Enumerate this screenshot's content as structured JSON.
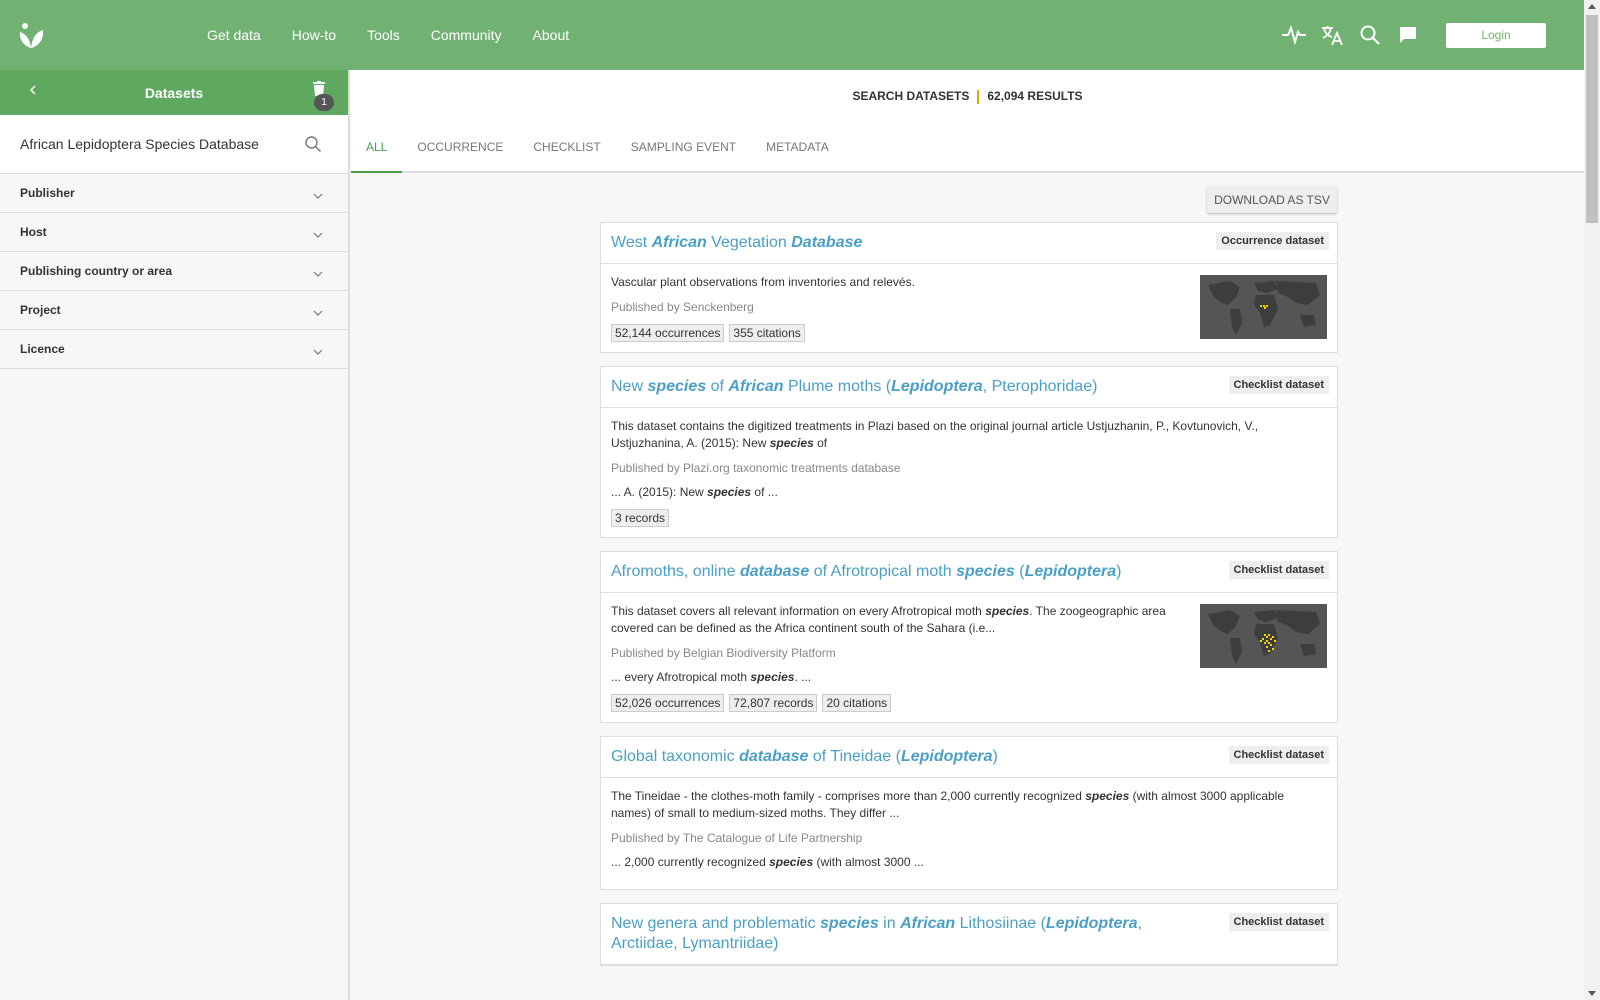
{
  "nav": {
    "items": [
      "Get data",
      "How-to",
      "Tools",
      "Community",
      "About"
    ],
    "login_label": "Login"
  },
  "sidebar": {
    "title": "Datasets",
    "badge_count": "1",
    "search_value": "African Lepidoptera Species Database",
    "filters": [
      "Publisher",
      "Host",
      "Publishing country or area",
      "Project",
      "Licence"
    ]
  },
  "results": {
    "label": "SEARCH DATASETS",
    "count": "62,094 RESULTS"
  },
  "tabs": [
    "ALL",
    "OCCURRENCE",
    "CHECKLIST",
    "SAMPLING EVENT",
    "METADATA"
  ],
  "download_label": "DOWNLOAD AS TSV",
  "datasets": [
    {
      "title_parts": [
        [
          "West ",
          false
        ],
        [
          "African",
          true
        ],
        [
          " Vegetation ",
          false
        ],
        [
          "Database",
          true
        ]
      ],
      "type": "Occurrence dataset",
      "description_parts": [
        [
          "Vascular plant observations from inventories and relevés.",
          false
        ]
      ],
      "published": "Published by Senckenberg",
      "snippet_parts": [],
      "tags": [
        "52,144 occurrences",
        "355 citations"
      ],
      "has_map": true
    },
    {
      "title_parts": [
        [
          "New ",
          false
        ],
        [
          "species",
          true
        ],
        [
          " of ",
          false
        ],
        [
          "African",
          true
        ],
        [
          " Plume moths (",
          false
        ],
        [
          "Lepidoptera",
          true
        ],
        [
          ", Pterophoridae)",
          false
        ]
      ],
      "type": "Checklist dataset",
      "description_parts": [
        [
          "This dataset contains the digitized treatments in Plazi based on the original journal article Ustjuzhanin, P., Kovtunovich, V., Ustjuzhanina, A. (2015): New ",
          false
        ],
        [
          "species",
          true
        ],
        [
          " of",
          false
        ]
      ],
      "published": "Published by Plazi.org taxonomic treatments database",
      "snippet_parts": [
        [
          "... A. (2015): New ",
          false
        ],
        [
          "species",
          true
        ],
        [
          " of ...",
          false
        ]
      ],
      "tags": [
        "3 records"
      ],
      "has_map": false
    },
    {
      "title_parts": [
        [
          "Afromoths, online ",
          false
        ],
        [
          "database",
          true
        ],
        [
          " of Afrotropical moth ",
          false
        ],
        [
          "species",
          true
        ],
        [
          " (",
          false
        ],
        [
          "Lepidoptera",
          true
        ],
        [
          ")",
          false
        ]
      ],
      "type": "Checklist dataset",
      "description_parts": [
        [
          "This dataset covers all relevant information on every Afrotropical moth ",
          false
        ],
        [
          "species",
          true
        ],
        [
          ". The zoogeographic area covered can be defined as the Africa continent south of the Sahara (i.e...",
          false
        ]
      ],
      "published": "Published by Belgian Biodiversity Platform",
      "snippet_parts": [
        [
          "... every Afrotropical moth ",
          false
        ],
        [
          "species",
          true
        ],
        [
          ". ...",
          false
        ]
      ],
      "tags": [
        "52,026 occurrences",
        "72,807 records",
        "20 citations"
      ],
      "has_map": true
    },
    {
      "title_parts": [
        [
          "Global taxonomic ",
          false
        ],
        [
          "database",
          true
        ],
        [
          " of Tineidae (",
          false
        ],
        [
          "Lepidoptera",
          true
        ],
        [
          ")",
          false
        ]
      ],
      "type": "Checklist dataset",
      "description_parts": [
        [
          "The Tineidae - the clothes-moth family - comprises more than 2,000 currently recognized ",
          false
        ],
        [
          "species",
          true
        ],
        [
          " (with almost 3000 applicable names) of small to medium-sized moths. They differ ...",
          false
        ]
      ],
      "published": "Published by The Catalogue of Life Partnership",
      "snippet_parts": [
        [
          "... 2,000 currently recognized ",
          false
        ],
        [
          "species",
          true
        ],
        [
          " (with almost 3000 ...",
          false
        ]
      ],
      "tags": [],
      "has_map": false
    },
    {
      "title_parts": [
        [
          "New genera and problematic ",
          false
        ],
        [
          "species",
          true
        ],
        [
          " in ",
          false
        ],
        [
          "African",
          true
        ],
        [
          " Lithosiinae (",
          false
        ],
        [
          "Lepidoptera",
          true
        ],
        [
          ", Arctiidae, Lymantriidae)",
          false
        ]
      ],
      "type": "Checklist dataset",
      "description_parts": [],
      "published": "",
      "snippet_parts": [],
      "tags": [],
      "has_map": false
    }
  ],
  "colors": {
    "topbar": "#71b171",
    "accent_green": "#4c9c4c",
    "link_blue": "#4a9fc6",
    "separator_gold": "#e3a500"
  }
}
